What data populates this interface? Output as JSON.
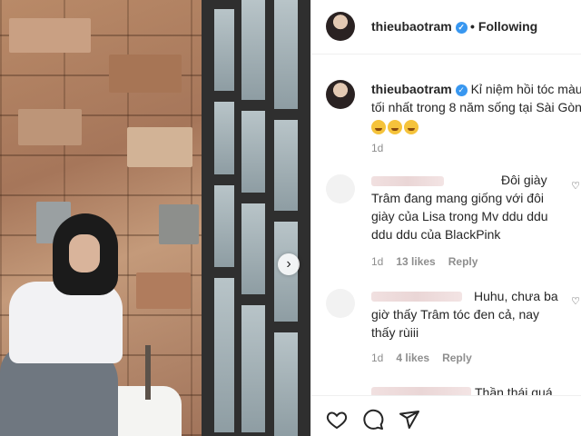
{
  "post": {
    "username": "thieubaotram",
    "follow_status": "Following",
    "follow_separator": "•",
    "verified_glyph": "✓"
  },
  "caption": {
    "username": "thieubaotram",
    "line1": "Kỉ niệm hồi tóc màu",
    "line2": "tối nhất trong 8 năm sống tại Sài Gòn",
    "emoji_icons": [
      "laughing-face-icon",
      "laughing-face-icon",
      "laughing-face-icon"
    ],
    "time": "1d"
  },
  "comments": [
    {
      "lines": [
        "Đôi giày",
        "Trâm đang mang giống với đôi",
        "giày của Lisa trong Mv ddu ddu",
        "ddu ddu của BlackPink"
      ],
      "time": "1d",
      "likes": "13 likes",
      "reply": "Reply"
    },
    {
      "lines": [
        "Huhu, chưa ba",
        "giờ thấy Trâm tóc đen cả, nay",
        "thấy rùiii"
      ],
      "time": "1d",
      "likes": "4 likes",
      "reply": "Reply"
    },
    {
      "lines": [
        "Thần thái quá"
      ]
    }
  ],
  "photo": {
    "next_glyph": "›"
  },
  "actions": {
    "icons": [
      "heart-icon",
      "comment-icon",
      "share-icon"
    ]
  },
  "colors": {
    "verified": "#3897f0",
    "meta_text": "#8e8e8e",
    "text": "#262626"
  }
}
